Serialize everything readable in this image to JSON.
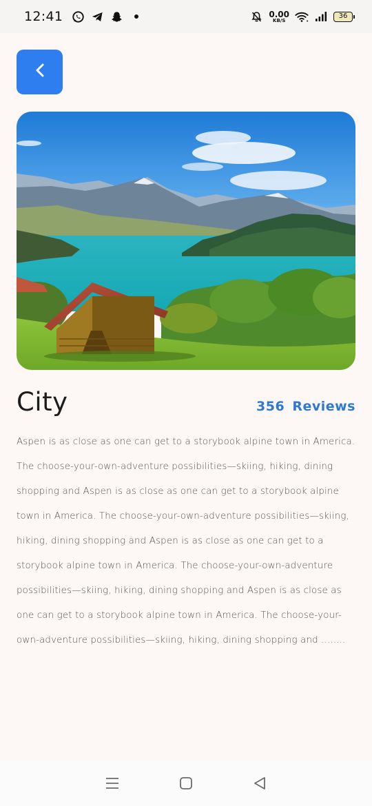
{
  "status_bar": {
    "time": "12:41",
    "net_speed_value": "0.00",
    "net_speed_unit": "KB/S",
    "battery_level": "36",
    "icons_left": [
      "whatsapp-icon",
      "telegram-icon",
      "snapchat-icon",
      "notification-dot"
    ],
    "icons_right": [
      "mute-bell-icon",
      "wifi-icon",
      "signal-icon",
      "battery-icon"
    ]
  },
  "header": {
    "back_icon": "chevron-left-icon"
  },
  "place": {
    "title": "City",
    "reviews_count": "356",
    "reviews_label": "Reviews",
    "description": "Aspen is as close as one can get to a storybook alpine town in America. The choose-your-own-adventure possibilities—skiing, hiking, dining shopping and Aspen is as close as one can get to a storybook alpine town in America. The choose-your-own-adventure possibilities—skiing, hiking, dining shopping and Aspen is as close as one can get to a storybook alpine town in America. The choose-your-own-adventure possibilities—skiing, hiking, dining shopping and Aspen is as close as one can get to a storybook alpine town in America. The choose-your-own-adventure possibilities—skiing, hiking, dining shopping and ........"
  },
  "nav_bar": {
    "icons": [
      "menu-icon",
      "home-icon",
      "back-triangle-icon"
    ]
  },
  "colors": {
    "accent": "#2f7ef0",
    "reviews": "#2f78d4",
    "background": "#fdf8f6"
  }
}
